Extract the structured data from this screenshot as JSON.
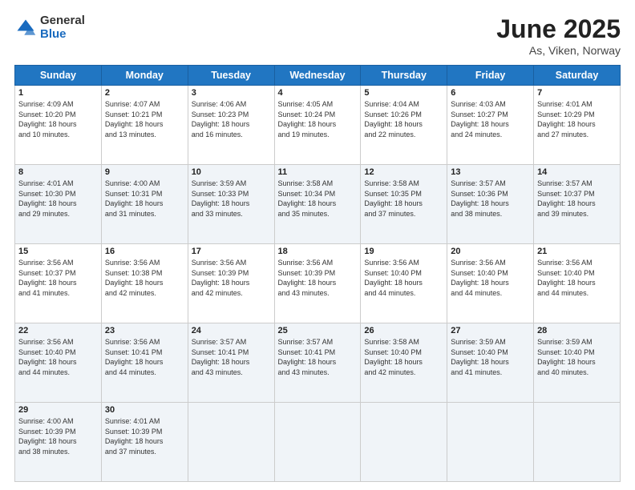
{
  "header": {
    "logo_general": "General",
    "logo_blue": "Blue",
    "title": "June 2025",
    "subtitle": "As, Viken, Norway"
  },
  "days_of_week": [
    "Sunday",
    "Monday",
    "Tuesday",
    "Wednesday",
    "Thursday",
    "Friday",
    "Saturday"
  ],
  "weeks": [
    [
      {
        "day": "1",
        "sunrise": "4:09 AM",
        "sunset": "10:20 PM",
        "daylight": "18 hours and 10 minutes."
      },
      {
        "day": "2",
        "sunrise": "4:07 AM",
        "sunset": "10:21 PM",
        "daylight": "18 hours and 13 minutes."
      },
      {
        "day": "3",
        "sunrise": "4:06 AM",
        "sunset": "10:23 PM",
        "daylight": "18 hours and 16 minutes."
      },
      {
        "day": "4",
        "sunrise": "4:05 AM",
        "sunset": "10:24 PM",
        "daylight": "18 hours and 19 minutes."
      },
      {
        "day": "5",
        "sunrise": "4:04 AM",
        "sunset": "10:26 PM",
        "daylight": "18 hours and 22 minutes."
      },
      {
        "day": "6",
        "sunrise": "4:03 AM",
        "sunset": "10:27 PM",
        "daylight": "18 hours and 24 minutes."
      },
      {
        "day": "7",
        "sunrise": "4:01 AM",
        "sunset": "10:29 PM",
        "daylight": "18 hours and 27 minutes."
      }
    ],
    [
      {
        "day": "8",
        "sunrise": "4:01 AM",
        "sunset": "10:30 PM",
        "daylight": "18 hours and 29 minutes."
      },
      {
        "day": "9",
        "sunrise": "4:00 AM",
        "sunset": "10:31 PM",
        "daylight": "18 hours and 31 minutes."
      },
      {
        "day": "10",
        "sunrise": "3:59 AM",
        "sunset": "10:33 PM",
        "daylight": "18 hours and 33 minutes."
      },
      {
        "day": "11",
        "sunrise": "3:58 AM",
        "sunset": "10:34 PM",
        "daylight": "18 hours and 35 minutes."
      },
      {
        "day": "12",
        "sunrise": "3:58 AM",
        "sunset": "10:35 PM",
        "daylight": "18 hours and 37 minutes."
      },
      {
        "day": "13",
        "sunrise": "3:57 AM",
        "sunset": "10:36 PM",
        "daylight": "18 hours and 38 minutes."
      },
      {
        "day": "14",
        "sunrise": "3:57 AM",
        "sunset": "10:37 PM",
        "daylight": "18 hours and 39 minutes."
      }
    ],
    [
      {
        "day": "15",
        "sunrise": "3:56 AM",
        "sunset": "10:37 PM",
        "daylight": "18 hours and 41 minutes."
      },
      {
        "day": "16",
        "sunrise": "3:56 AM",
        "sunset": "10:38 PM",
        "daylight": "18 hours and 42 minutes."
      },
      {
        "day": "17",
        "sunrise": "3:56 AM",
        "sunset": "10:39 PM",
        "daylight": "18 hours and 42 minutes."
      },
      {
        "day": "18",
        "sunrise": "3:56 AM",
        "sunset": "10:39 PM",
        "daylight": "18 hours and 43 minutes."
      },
      {
        "day": "19",
        "sunrise": "3:56 AM",
        "sunset": "10:40 PM",
        "daylight": "18 hours and 44 minutes."
      },
      {
        "day": "20",
        "sunrise": "3:56 AM",
        "sunset": "10:40 PM",
        "daylight": "18 hours and 44 minutes."
      },
      {
        "day": "21",
        "sunrise": "3:56 AM",
        "sunset": "10:40 PM",
        "daylight": "18 hours and 44 minutes."
      }
    ],
    [
      {
        "day": "22",
        "sunrise": "3:56 AM",
        "sunset": "10:40 PM",
        "daylight": "18 hours and 44 minutes."
      },
      {
        "day": "23",
        "sunrise": "3:56 AM",
        "sunset": "10:41 PM",
        "daylight": "18 hours and 44 minutes."
      },
      {
        "day": "24",
        "sunrise": "3:57 AM",
        "sunset": "10:41 PM",
        "daylight": "18 hours and 43 minutes."
      },
      {
        "day": "25",
        "sunrise": "3:57 AM",
        "sunset": "10:41 PM",
        "daylight": "18 hours and 43 minutes."
      },
      {
        "day": "26",
        "sunrise": "3:58 AM",
        "sunset": "10:40 PM",
        "daylight": "18 hours and 42 minutes."
      },
      {
        "day": "27",
        "sunrise": "3:59 AM",
        "sunset": "10:40 PM",
        "daylight": "18 hours and 41 minutes."
      },
      {
        "day": "28",
        "sunrise": "3:59 AM",
        "sunset": "10:40 PM",
        "daylight": "18 hours and 40 minutes."
      }
    ],
    [
      {
        "day": "29",
        "sunrise": "4:00 AM",
        "sunset": "10:39 PM",
        "daylight": "18 hours and 38 minutes."
      },
      {
        "day": "30",
        "sunrise": "4:01 AM",
        "sunset": "10:39 PM",
        "daylight": "18 hours and 37 minutes."
      },
      null,
      null,
      null,
      null,
      null
    ]
  ]
}
